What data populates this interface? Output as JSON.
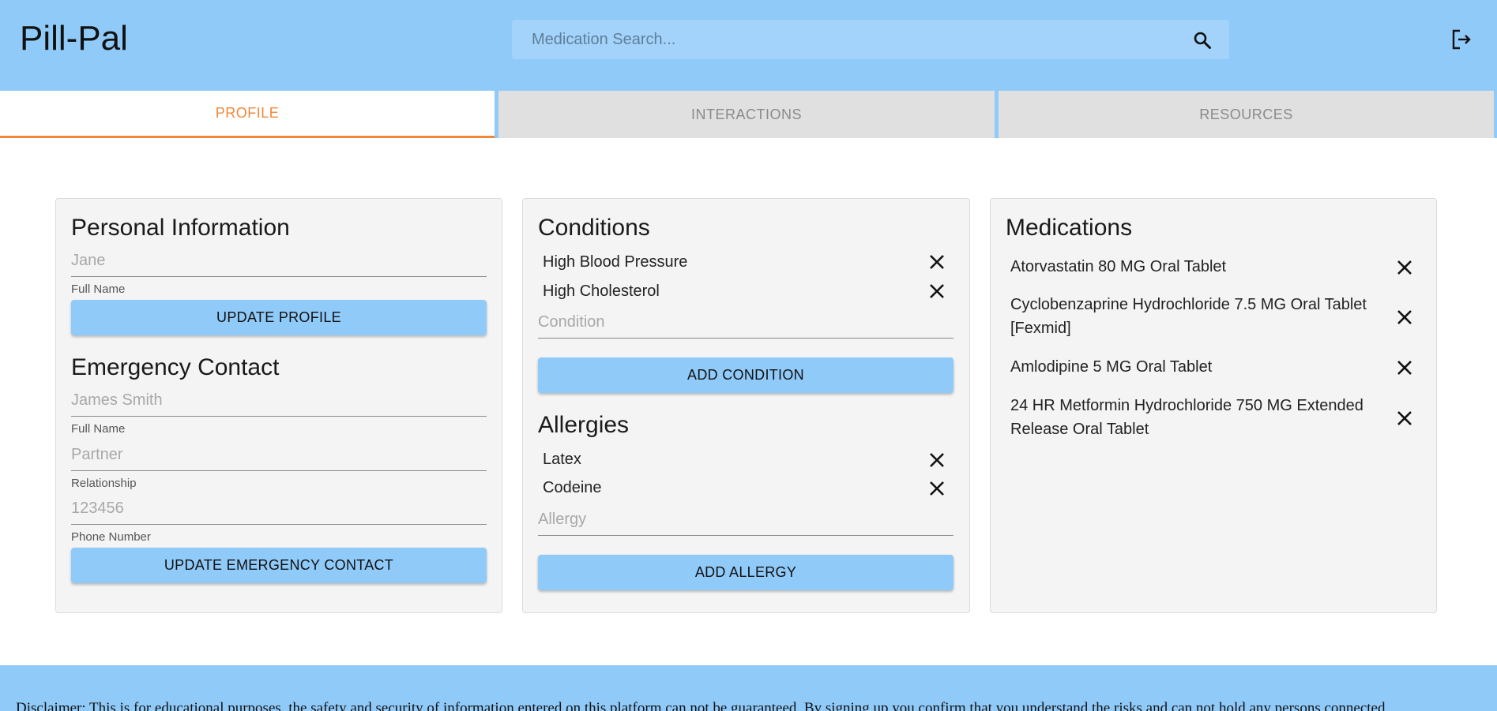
{
  "header": {
    "app_title": "Pill-Pal",
    "search_placeholder": "Medication Search...",
    "search_icon": "search-icon",
    "logout_icon": "logout-icon"
  },
  "tabs": [
    {
      "label": "PROFILE",
      "active": true
    },
    {
      "label": "INTERACTIONS",
      "active": false
    },
    {
      "label": "RESOURCES",
      "active": false
    }
  ],
  "personal": {
    "title": "Personal Information",
    "name_placeholder": "Jane",
    "name_helper": "Full Name",
    "update_button": "UPDATE PROFILE"
  },
  "emergency": {
    "title": "Emergency Contact",
    "name_placeholder": "James Smith",
    "name_helper": "Full Name",
    "relationship_placeholder": "Partner",
    "relationship_helper": "Relationship",
    "phone_placeholder": "123456",
    "phone_helper": "Phone Number",
    "update_button": "UPDATE EMERGENCY CONTACT"
  },
  "conditions": {
    "title": "Conditions",
    "items": [
      "High Blood Pressure",
      "High Cholesterol"
    ],
    "input_placeholder": "Condition",
    "add_button": "ADD CONDITION"
  },
  "allergies": {
    "title": "Allergies",
    "items": [
      "Latex",
      "Codeine"
    ],
    "input_placeholder": "Allergy",
    "add_button": "ADD ALLERGY"
  },
  "medications": {
    "title": "Medications",
    "items": [
      "Atorvastatin 80 MG Oral Tablet",
      "Cyclobenzaprine Hydrochloride 7.5 MG Oral Tablet [Fexmid]",
      "Amlodipine 5 MG Oral Tablet",
      "24 HR Metformin Hydrochloride 750 MG Extended Release Oral Tablet"
    ]
  },
  "footer": {
    "disclaimer": "Disclaimer: This is for educational purposes, the safety and security of information entered on this platform can not be guaranteed. By signing up you confirm that you understand the risks and can not hold any persons connected"
  },
  "colors": {
    "primary": "#90caf9",
    "accent": "#f0883a",
    "card_bg": "#f4f4f4",
    "tab_inactive": "#e0e0e0"
  }
}
